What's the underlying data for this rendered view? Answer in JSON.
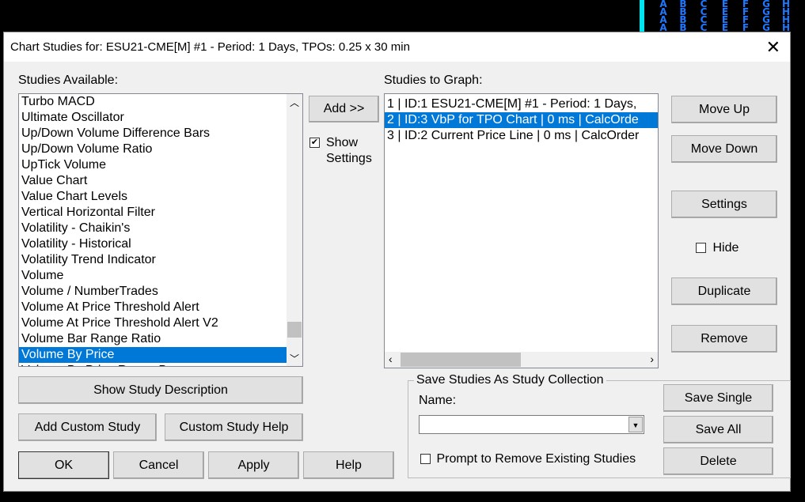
{
  "background_columns": [
    "A",
    "B",
    "C",
    "E",
    "F",
    "G",
    "H"
  ],
  "title": "Chart Studies for: ESU21-CME[M]  #1 - Period: 1 Days, TPOs: 0.25 x 30 min",
  "studies_available_label": "Studies Available:",
  "studies_available": [
    "Turbo MACD",
    "Ultimate Oscillator",
    "Up/Down Volume Difference Bars",
    "Up/Down Volume Ratio",
    "UpTick Volume",
    "Value Chart",
    "Value Chart Levels",
    "Vertical Horizontal Filter",
    "Volatility - Chaikin's",
    "Volatility - Historical",
    "Volatility Trend Indicator",
    "Volume",
    "Volume / NumberTrades",
    "Volume At Price Threshold Alert",
    "Volume At Price Threshold Alert V2",
    "Volume Bar Range Ratio",
    "Volume By Price",
    "Volume By Price Range Bars"
  ],
  "selected_available": "Volume By Price",
  "add_button": "Add >>",
  "show_settings": {
    "label1": "Show",
    "label2": "Settings",
    "checked": true
  },
  "studies_to_graph_label": "Studies to Graph:",
  "studies_to_graph": [
    "1 | ID:1  ESU21-CME[M]  #1 - Period: 1 Days,",
    "2 | ID:3  VbP for TPO Chart | 0 ms | CalcOrde",
    "3 | ID:2  Current Price Line | 0 ms | CalcOrder"
  ],
  "buttons": {
    "move_up": "Move Up",
    "move_down": "Move Down",
    "settings": "Settings",
    "hide": "Hide",
    "duplicate": "Duplicate",
    "remove": "Remove",
    "show_desc": "Show Study Description",
    "add_custom": "Add Custom Study",
    "custom_help": "Custom Study Help",
    "ok": "OK",
    "cancel": "Cancel",
    "apply": "Apply",
    "help": "Help",
    "save_single": "Save Single",
    "save_all": "Save All",
    "delete": "Delete"
  },
  "collection": {
    "group_label": "Save Studies As Study Collection",
    "name_label": "Name:",
    "name_value": "",
    "prompt_label": "Prompt to Remove Existing Studies",
    "prompt_checked": false
  },
  "colors": {
    "selection": "#0078d7",
    "dialog_bg": "#f0f0f0"
  }
}
